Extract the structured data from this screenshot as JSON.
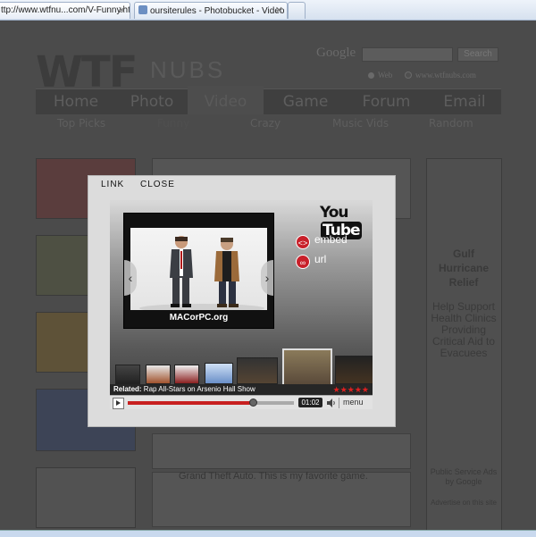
{
  "browser": {
    "tabs": [
      {
        "label": "ttp://www.wtfnu...com/V-Funny.htm"
      },
      {
        "label": "oursiterules - Photobucket - Video a..."
      }
    ]
  },
  "site": {
    "logo_text": "WTF",
    "logo_sub": "NUBS",
    "google_label": "Google",
    "search_button": "Search",
    "search_option_web": "Web",
    "search_option_site": "www.wtfnubs.com",
    "nav": [
      "Home",
      "Photo",
      "Video",
      "Game",
      "Forum",
      "Email"
    ],
    "active_nav": "Video",
    "subnav": [
      "Top Picks",
      "Funny",
      "Crazy",
      "Music Vids",
      "Random"
    ],
    "content_text": "Grand Theft Auto. This is my favorite game.",
    "ad": {
      "title": "Gulf Hurricane Relief",
      "body": "Help Support Health Clinics Providing Critical Aid to Evacuees",
      "psa": "Public Service Ads by Google",
      "advertise": "Advertise on this site"
    }
  },
  "lightbox": {
    "link_label": "LINK",
    "close_label": "CLOSE",
    "player": {
      "brand_you": "You",
      "brand_tube": "Tube",
      "watermark": "MACorPC.org",
      "embed_label": "embed",
      "url_label": "url",
      "related_prefix": "Related:",
      "related_title": "Rap All-Stars on Arsenio Hall Show",
      "rating_stars": "★★★★★",
      "time": "01:02",
      "menu_label": "menu",
      "progress": 0.75
    }
  },
  "colors": {
    "accent_red": "#c8202a",
    "overlay_gray": "#4b4b4b"
  }
}
